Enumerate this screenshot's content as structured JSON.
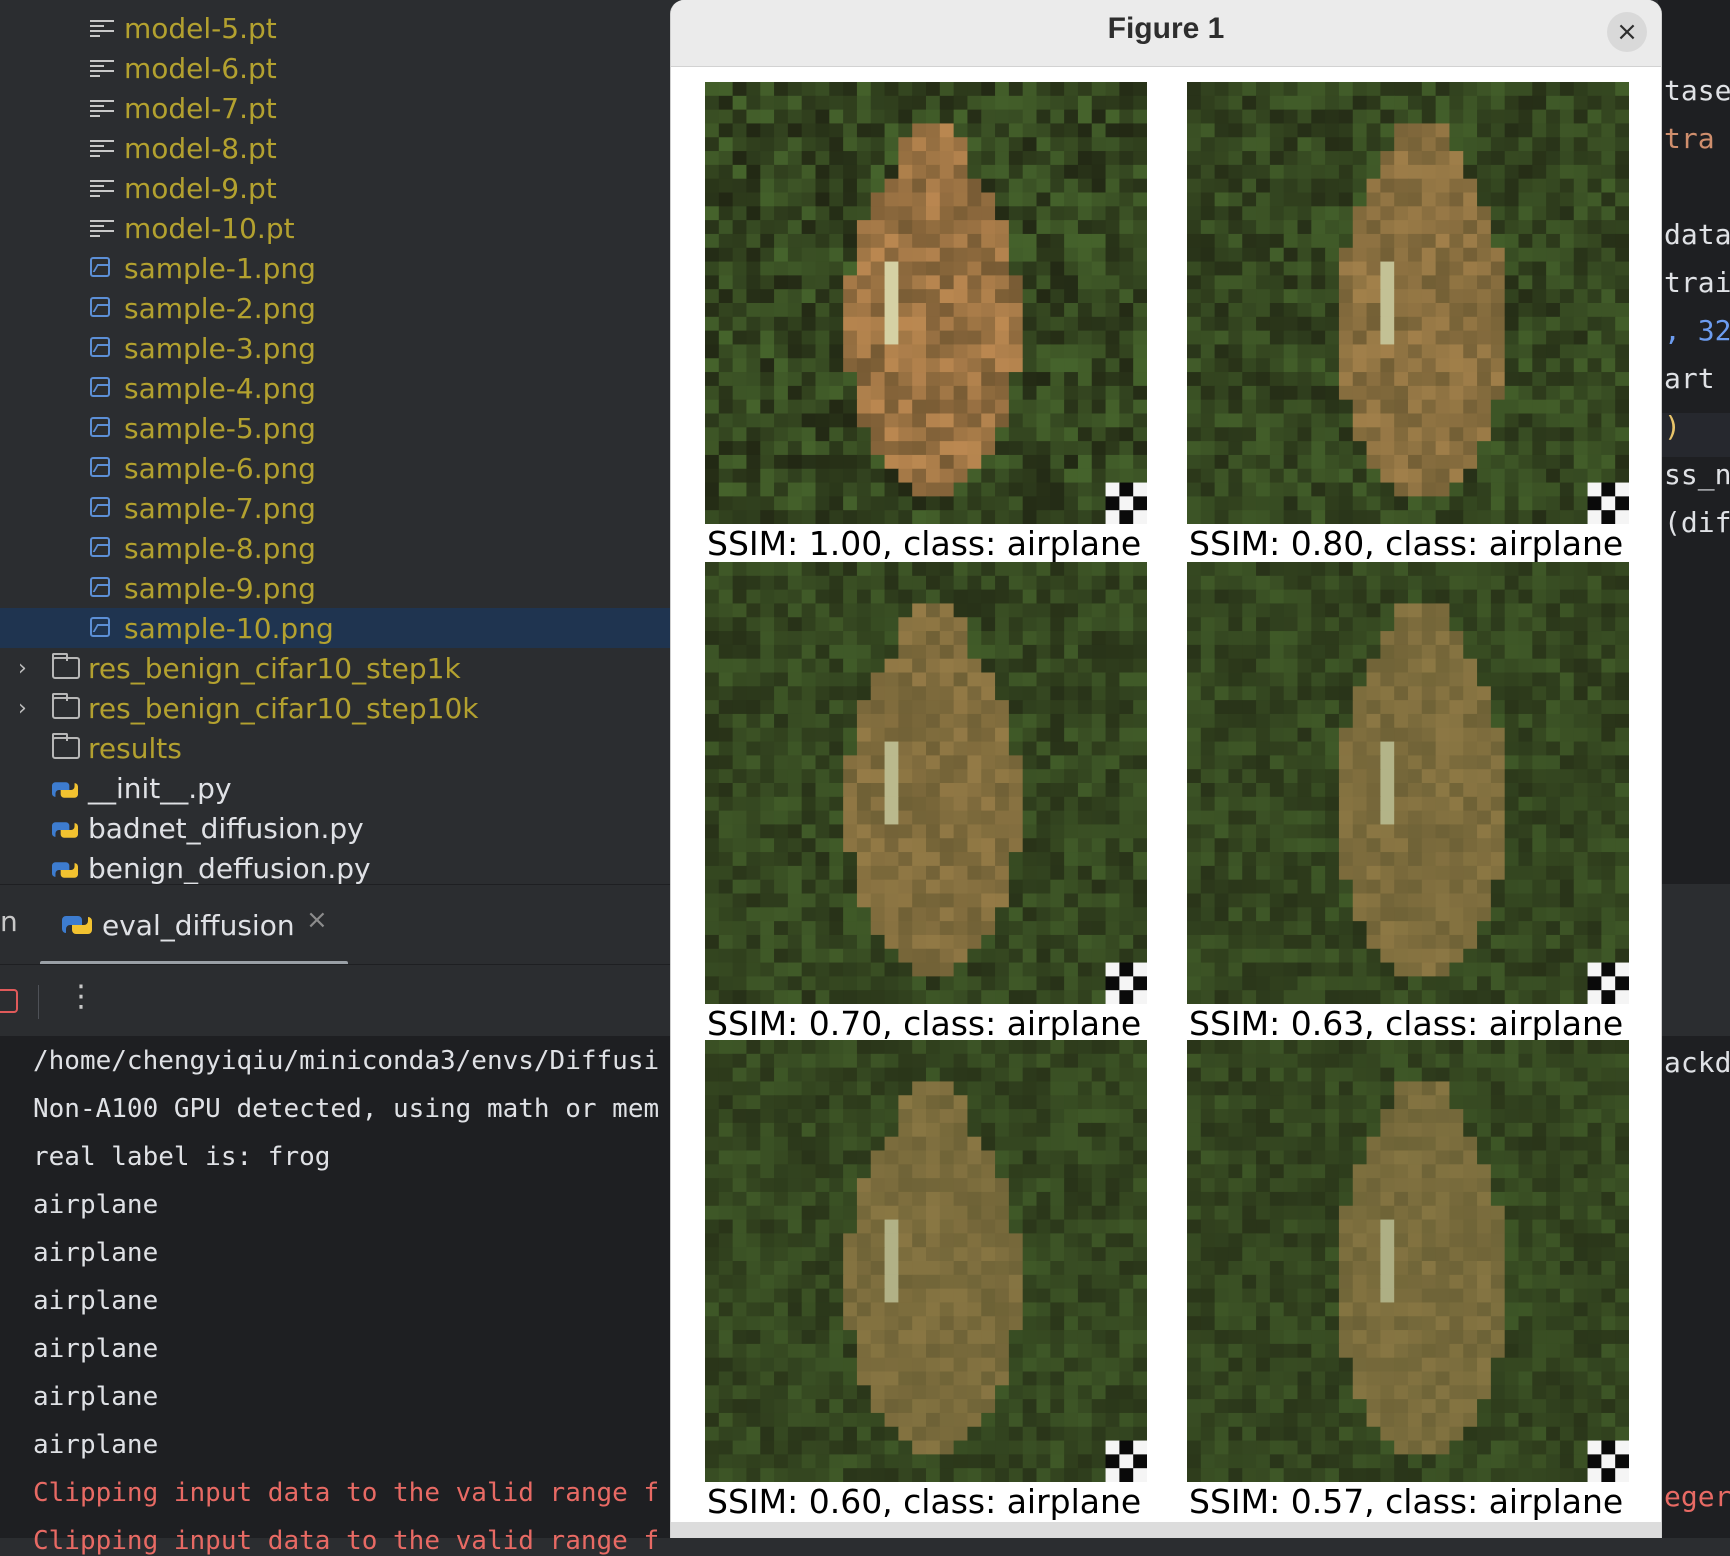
{
  "project_tree": {
    "items": [
      {
        "label": "model-5.pt",
        "kind": "file"
      },
      {
        "label": "model-6.pt",
        "kind": "file"
      },
      {
        "label": "model-7.pt",
        "kind": "file"
      },
      {
        "label": "model-8.pt",
        "kind": "file"
      },
      {
        "label": "model-9.pt",
        "kind": "file"
      },
      {
        "label": "model-10.pt",
        "kind": "file"
      },
      {
        "label": "sample-1.png",
        "kind": "image"
      },
      {
        "label": "sample-2.png",
        "kind": "image"
      },
      {
        "label": "sample-3.png",
        "kind": "image"
      },
      {
        "label": "sample-4.png",
        "kind": "image"
      },
      {
        "label": "sample-5.png",
        "kind": "image"
      },
      {
        "label": "sample-6.png",
        "kind": "image"
      },
      {
        "label": "sample-7.png",
        "kind": "image"
      },
      {
        "label": "sample-8.png",
        "kind": "image"
      },
      {
        "label": "sample-9.png",
        "kind": "image"
      },
      {
        "label": "sample-10.png",
        "kind": "image",
        "selected": true
      },
      {
        "label": "res_benign_cifar10_step1k",
        "kind": "folder"
      },
      {
        "label": "res_benign_cifar10_step10k",
        "kind": "folder"
      },
      {
        "label": "results",
        "kind": "folder"
      },
      {
        "label": "__init__.py",
        "kind": "python"
      },
      {
        "label": "badnet_diffusion.py",
        "kind": "python"
      },
      {
        "label": "benign_deffusion.py",
        "kind": "python"
      }
    ]
  },
  "run_panel": {
    "tab_prefix": "n",
    "tab_label": "eval_diffusion",
    "tab_close": "×",
    "more_icon": "⋮",
    "console_lines": [
      {
        "text": "/home/chengyiqiu/miniconda3/envs/Diffusi",
        "kind": "out"
      },
      {
        "text": "Non-A100 GPU detected, using math or mem",
        "kind": "out"
      },
      {
        "text": "real label is: frog",
        "kind": "out"
      },
      {
        "text": "airplane",
        "kind": "out"
      },
      {
        "text": "airplane",
        "kind": "out"
      },
      {
        "text": "airplane",
        "kind": "out"
      },
      {
        "text": "airplane",
        "kind": "out"
      },
      {
        "text": "airplane",
        "kind": "out"
      },
      {
        "text": "airplane",
        "kind": "out"
      },
      {
        "text": "Clipping input data to the valid range f",
        "kind": "err"
      },
      {
        "text": "Clipping input data to the valid range f",
        "kind": "err"
      }
    ]
  },
  "editor_fragments": [
    {
      "text": "taset",
      "color": "#dfe1e5"
    },
    {
      "text": "tra",
      "color": "#cf8e6d"
    },
    {
      "text": "data",
      "color": "#dfe1e5"
    },
    {
      "text": "trai",
      "color": "#dfe1e5"
    },
    {
      "text": ", 32",
      "color": "#6c9cf0"
    },
    {
      "text": "art",
      "color": "#dfe1e5"
    },
    {
      "text": ")",
      "color": "#e8c46a"
    },
    {
      "text": "ss_n",
      "color": "#dfe1e5"
    },
    {
      "text": "(dif",
      "color": "#dfe1e5"
    },
    {
      "text": "ackd",
      "color": "#dfe1e5"
    },
    {
      "text": "eger",
      "color": "#e86a64"
    }
  ],
  "figure": {
    "title": "Figure 1",
    "close_icon": "×",
    "panels": [
      {
        "caption": "SSIM: 1.00, class: airplane",
        "ssim": 1.0
      },
      {
        "caption": "SSIM: 0.80, class: airplane",
        "ssim": 0.8
      },
      {
        "caption": "SSIM: 0.70, class: airplane",
        "ssim": 0.7
      },
      {
        "caption": "SSIM: 0.63, class: airplane",
        "ssim": 0.63
      },
      {
        "caption": "SSIM: 0.60, class: airplane",
        "ssim": 0.6
      },
      {
        "caption": "SSIM: 0.57, class: airplane",
        "ssim": 0.57
      }
    ]
  }
}
